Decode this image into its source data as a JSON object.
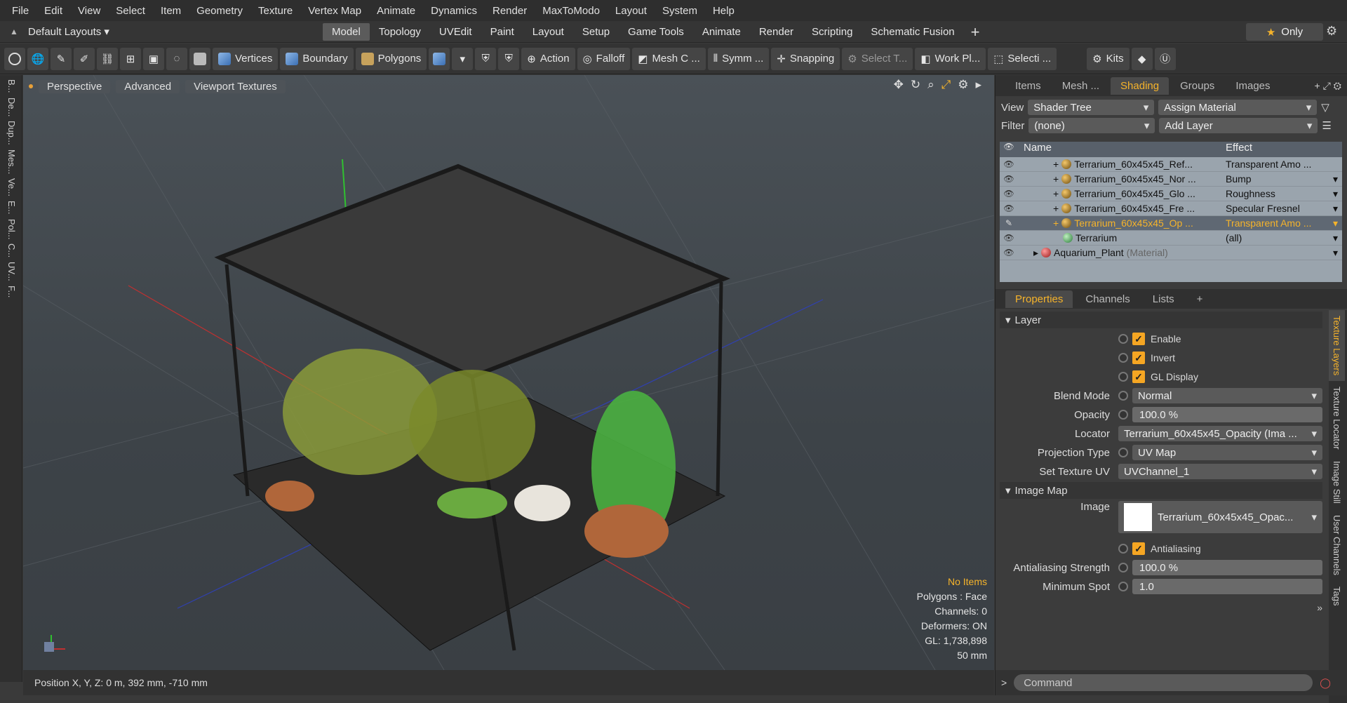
{
  "menu": [
    "File",
    "Edit",
    "View",
    "Select",
    "Item",
    "Geometry",
    "Texture",
    "Vertex Map",
    "Animate",
    "Dynamics",
    "Render",
    "MaxToModo",
    "Layout",
    "System",
    "Help"
  ],
  "layout": {
    "name": "Default Layouts",
    "only_label": "Only"
  },
  "mode_tabs": [
    "Model",
    "Topology",
    "UVEdit",
    "Paint",
    "Layout",
    "Setup",
    "Game Tools",
    "Animate",
    "Render",
    "Scripting",
    "Schematic Fusion"
  ],
  "toolbar": {
    "vertices": "Vertices",
    "boundary": "Boundary",
    "polygons": "Polygons",
    "action": "Action",
    "falloff": "Falloff",
    "mesh": "Mesh C ...",
    "symm": "Symm ...",
    "snapping": "Snapping",
    "select_t": "Select T...",
    "work_pl": "Work Pl...",
    "selecti": "Selecti ...",
    "kits": "Kits"
  },
  "left_strip": [
    "B...",
    "De...",
    "Dup...",
    "Mes...",
    "Ve...",
    "E...",
    "Pol...",
    "C...",
    "UV...",
    "F..."
  ],
  "viewport": {
    "perspective": "Perspective",
    "advanced": "Advanced",
    "textures": "Viewport Textures",
    "stats": {
      "no_items": "No Items",
      "polygons": "Polygons : Face",
      "channels": "Channels: 0",
      "deformers": "Deformers: ON",
      "gl": "GL: 1,738,898",
      "focal": "50 mm"
    }
  },
  "status": {
    "position": "Position X, Y, Z:  0 m, 392 mm, -710 mm"
  },
  "right_tabs": [
    "Items",
    "Mesh ...",
    "Shading",
    "Groups",
    "Images"
  ],
  "shader": {
    "view_label": "View",
    "view_value": "Shader Tree",
    "assign": "Assign Material",
    "filter_label": "Filter",
    "filter_value": "(none)",
    "add_layer": "Add Layer",
    "col_name": "Name",
    "col_effect": "Effect",
    "rows": [
      {
        "name": "Terrarium_60x45x45_Ref...",
        "effect": "Transparent Amo ..."
      },
      {
        "name": "Terrarium_60x45x45_Nor ...",
        "effect": "Bump"
      },
      {
        "name": "Terrarium_60x45x45_Glo ...",
        "effect": "Roughness"
      },
      {
        "name": "Terrarium_60x45x45_Fre ...",
        "effect": "Specular Fresnel"
      },
      {
        "name": "Terrarium_60x45x45_Op ...",
        "effect": "Transparent Amo ..."
      },
      {
        "name": "Terrarium",
        "effect": "(all)"
      },
      {
        "name": "Aquarium_Plant",
        "suffix": "(Material)",
        "effect": ""
      }
    ]
  },
  "props_tabs": [
    "Properties",
    "Channels",
    "Lists"
  ],
  "props": {
    "layer_section": "Layer",
    "enable": "Enable",
    "invert": "Invert",
    "gl_display": "GL Display",
    "blend_label": "Blend Mode",
    "blend_value": "Normal",
    "opacity_label": "Opacity",
    "opacity_value": "100.0 %",
    "locator_label": "Locator",
    "locator_value": "Terrarium_60x45x45_Opacity (Ima ...",
    "proj_label": "Projection Type",
    "proj_value": "UV Map",
    "setuv_label": "Set Texture UV",
    "setuv_value": "UVChannel_1",
    "imagemap_section": "Image Map",
    "image_label": "Image",
    "image_value": "Terrarium_60x45x45_Opac...",
    "antialias": "Antialiasing",
    "aa_strength_label": "Antialiasing Strength",
    "aa_strength_value": "100.0 %",
    "min_spot_label": "Minimum Spot",
    "min_spot_value": "1.0"
  },
  "vert_tabs": [
    "Texture Layers",
    "Texture Locator",
    "Image Still",
    "User Channels",
    "Tags"
  ],
  "command_placeholder": "Command"
}
